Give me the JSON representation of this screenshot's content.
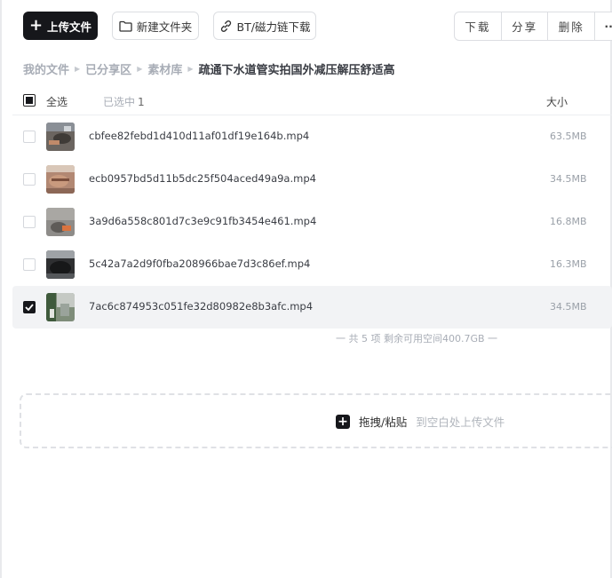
{
  "toolbar": {
    "upload_label": "上传文件",
    "new_folder_label": "新建文件夹",
    "bt_label": "BT/磁力链下载",
    "download_label": "下载",
    "share_label": "分享",
    "delete_label": "删除",
    "more_label": "··"
  },
  "breadcrumb": {
    "items": [
      "我的文件",
      "已分享区",
      "素材库"
    ],
    "current": "疏通下水道管实拍国外减压解压舒适高"
  },
  "list_header": {
    "select_all_label": "全选",
    "selected_label": "已选中",
    "selected_count": "1",
    "size_label": "大小"
  },
  "files": [
    {
      "name": "cbfee82febd1d410d11af01df19e164b.mp4",
      "size": "63.5MB",
      "selected": false
    },
    {
      "name": "ecb0957bd5d11b5dc25f504aced49a9a.mp4",
      "size": "34.5MB",
      "selected": false
    },
    {
      "name": "3a9d6a558c801d7c3e9c91fb3454e461.mp4",
      "size": "16.8MB",
      "selected": false
    },
    {
      "name": "5c42a7a2d9f0fba208966bae7d3c86ef.mp4",
      "size": "16.3MB",
      "selected": false
    },
    {
      "name": "7ac6c874953c051fe32d80982e8b3afc.mp4",
      "size": "34.5MB",
      "selected": true
    }
  ],
  "summary": "一 共 5 项 剩余可用空间400.7GB 一",
  "dropzone": {
    "main_label": "拖拽/粘贴",
    "hint_label": "到空白处上传文件"
  },
  "colors": {
    "primary": "#16171b",
    "muted_text": "#a8adb6",
    "selected_row_bg": "#f2f3f5"
  }
}
